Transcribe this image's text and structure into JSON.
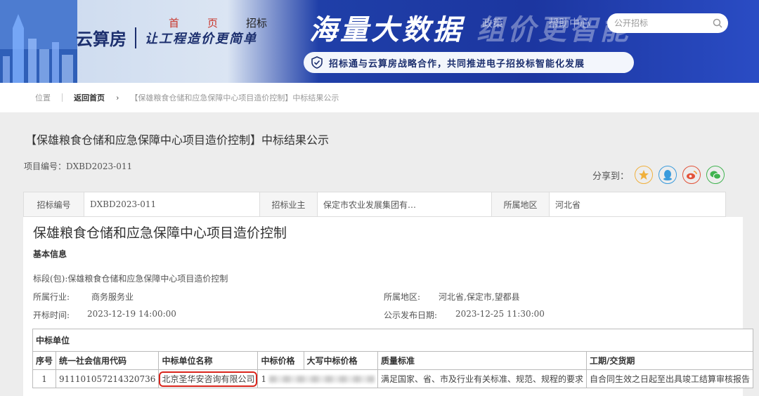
{
  "banner": {
    "logo_mark": "云算房",
    "slogan": "让工程造价更简单",
    "nav": [
      "首",
      "页",
      "招标",
      "政策",
      "帮助中心"
    ],
    "headline": "海量大数据",
    "headline_fade": "组价更智能",
    "search_placeholder": "公开招标",
    "partnership": "招标通与云算房战略合作，共同推进电子招投标智能化发展"
  },
  "breadcrumb": {
    "position": "位置",
    "home": "返回首页",
    "current": "【保雄粮食仓储和应急保障中心项目造价控制】中标结果公示"
  },
  "page": {
    "title": "【保雄粮食仓储和应急保障中心项目造价控制】中标结果公示",
    "project_no": "项目编号：DXBD2023-011",
    "share_label": "分享到："
  },
  "info_row": [
    {
      "label": "招标编号",
      "value": "DXBD2023-011"
    },
    {
      "label": "招标业主",
      "value": "保定市农业发展集团有…"
    },
    {
      "label": "所属地区",
      "value": "河北省"
    }
  ],
  "detail": {
    "title": "保雄粮食仓储和应急保障中心项目造价控制",
    "basic_info": "基本信息",
    "lot": "标段(包):保雄粮食仓储和应急保障中心项目造价控制",
    "industry_label": "所属行业:",
    "industry_value": "商务服务业",
    "region_label": "所属地区:",
    "region_value": "河北省,保定市,望都县",
    "open_time_label": "开标时间:",
    "open_time_value": "2023-12-19 14:00:00",
    "publish_label": "公示发布日期:",
    "publish_value": "2023-12-25 11:30:00"
  },
  "award": {
    "section_title": "中标单位",
    "headers": [
      "序号",
      "统一社会信用代码",
      "中标单位名称",
      "中标价格",
      "大写中标价格",
      "质量标准",
      "工期/交货期"
    ],
    "row": {
      "index": "1",
      "credit_code": "911101057214320736",
      "company": "北京圣华安咨询有限公司",
      "price_prefix": "1",
      "quality": "满足国家、省、市及行业有关标准、规范、规程的要求",
      "period": "自合同生效之日起至出具竣工结算审核报告"
    }
  }
}
